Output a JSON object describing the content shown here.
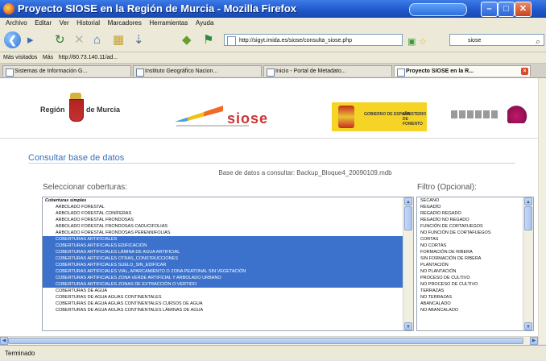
{
  "window": {
    "title": "Proyecto SIOSE en la Región de Murcia - Mozilla Firefox"
  },
  "menu": [
    "Archivo",
    "Editar",
    "Ver",
    "Historial",
    "Marcadores",
    "Herramientas",
    "Ayuda"
  ],
  "nav": {
    "url": "http://sigyt.imida.es/siose/consulta_siose.php",
    "search_placeholder": "siose"
  },
  "bookmarks": [
    "Más visitados",
    "Más",
    "http://80.73.140.11/ad..."
  ],
  "tabs": [
    "Sistemas de Información G...",
    "Instituto Geográfico Nacion...",
    "Inicio - Portal de Metadato...",
    "Proyecto SIOSE en la R..."
  ],
  "header": {
    "region_left": "Región",
    "region_right": "de Murcia",
    "siose_logo": "siose",
    "gov_text_1": "GOBIERNO DE ESPAÑA",
    "gov_text_2": "MINISTERIO DE FOMENTO"
  },
  "page": {
    "heading": "Consultar base de datos",
    "db_line": "Base de datos a consultar: Backup_Bloque4_20090109.mdb",
    "select_label": "Seleccionar coberturas:",
    "filter_label": "Filtro (Opcional):"
  },
  "coverage_list": [
    {
      "text": "Coberturas simples",
      "group": true,
      "selected": false
    },
    {
      "text": "ARBOLADO FORESTAL",
      "group": false,
      "selected": false
    },
    {
      "text": "ARBOLADO FORESTAL CONÍFERAS",
      "group": false,
      "selected": false
    },
    {
      "text": "ARBOLADO FORESTAL FRONDOSAS",
      "group": false,
      "selected": false
    },
    {
      "text": "ARBOLADO FORESTAL FRONDOSAS CADUCIFOLIAS",
      "group": false,
      "selected": false
    },
    {
      "text": "ARBOLADO FORESTAL FRONDOSAS PERENNIFOLIAS",
      "group": false,
      "selected": false
    },
    {
      "text": "COBERTURAS ARTIFICIALES",
      "group": false,
      "selected": true
    },
    {
      "text": "COBERTURAS ARTIFICIALES EDIFICACIÓN",
      "group": false,
      "selected": true
    },
    {
      "text": "COBERTURAS ARTIFICIALES LÁMINA DE AGUA ARTIFICIAL",
      "group": false,
      "selected": true
    },
    {
      "text": "COBERTURAS ARTIFICIALES OTRAS_CONSTRUCCIONES",
      "group": false,
      "selected": true
    },
    {
      "text": "COBERTURAS ARTIFICIALES SUELO_SIN_EDIFICAR",
      "group": false,
      "selected": true
    },
    {
      "text": "COBERTURAS ARTIFICIALES VIAL, APARCAMIENTO O ZONA PEATONAL SIN VEGETACIÓN",
      "group": false,
      "selected": true
    },
    {
      "text": "COBERTURAS ARTIFICIALES ZONA VERDE ARTIFICIAL Y ARBOLADO URBANO",
      "group": false,
      "selected": true
    },
    {
      "text": "COBERTURAS ARTIFICIALES ZONAS DE EXTRACCIÓN O VERTIDO",
      "group": false,
      "selected": true
    },
    {
      "text": "COBERTURAS DE AGUA",
      "group": false,
      "selected": false
    },
    {
      "text": "COBERTURAS DE AGUA AGUAS CONTINENTALES",
      "group": false,
      "selected": false
    },
    {
      "text": "COBERTURAS DE AGUA AGUAS CONTINENTALES CURSOS DE AGUA",
      "group": false,
      "selected": false
    },
    {
      "text": "COBERTURAS DE AGUA AGUAS CONTINENTALES LÁMINAS DE AGUA",
      "group": false,
      "selected": false
    }
  ],
  "filter_list": [
    "SECANO",
    "REGADÍO",
    "REGADÍO REGADO",
    "REGADÍO NO REGADO",
    "FUNCIÓN DE CORTAFUEGOS",
    "NO FUNCIÓN DE CORTAFUEGOS",
    "CORTAS",
    "NO CORTAS",
    "FORMACIÓN DE RIBERA",
    "SIN FORMACIÓN DE RIBERA",
    "PLANTACIÓN",
    "NO PLANTACIÓN",
    "PROCESO DE CULTIVO",
    "NO PROCESO DE CULTIVO",
    "TERRAZAS",
    "NO TERRAZAS",
    "ABANCALADO",
    "NO ABANCALADO"
  ],
  "status": {
    "text": "Terminado"
  }
}
